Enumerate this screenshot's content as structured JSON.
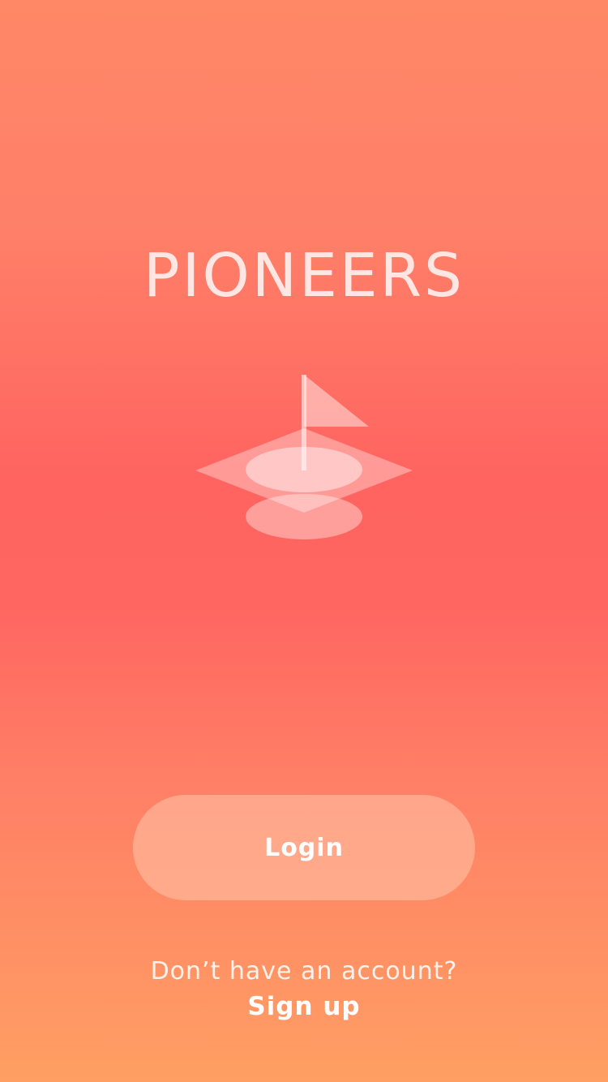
{
  "brand": {
    "title": "PIONEERS",
    "logo_icon": "golf-flag-icon"
  },
  "actions": {
    "login_label": "Login"
  },
  "signup": {
    "prompt": "Don’t have an account?",
    "link_label": "Sign up"
  },
  "colors": {
    "background_top": "#ff8867",
    "background_mid": "#ff6460",
    "background_bottom": "#ff9f63",
    "text_light": "#ffe6e2",
    "button_fill": "#ffc4aa"
  }
}
